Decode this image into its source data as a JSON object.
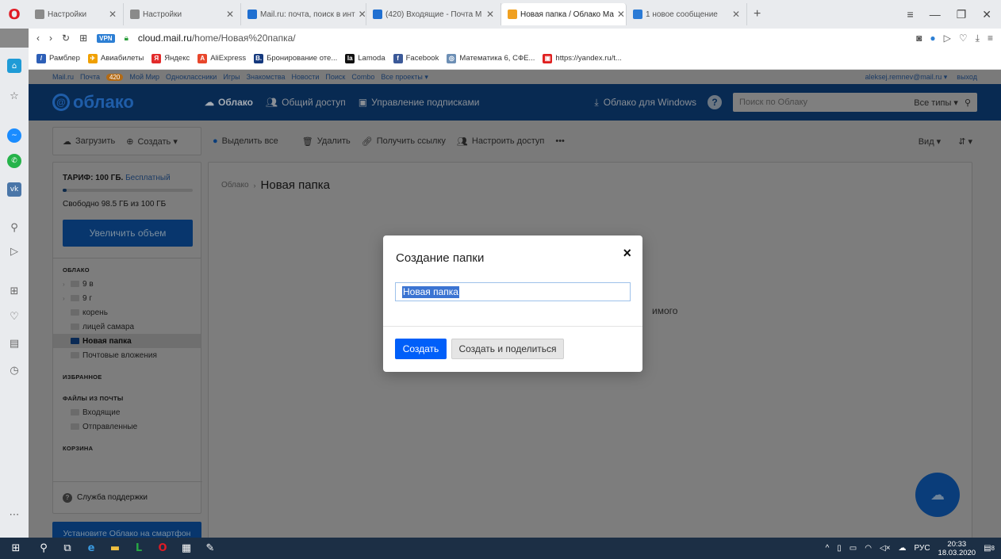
{
  "browser": {
    "tabs": [
      {
        "label": "Настройки",
        "icon": "gear-icon",
        "color": "#777777"
      },
      {
        "label": "Настройки",
        "icon": "gear-icon",
        "color": "#777777"
      },
      {
        "label": "Mail.ru: почта, поиск в инт",
        "icon": "mailru-icon",
        "color": "#1f6fd1"
      },
      {
        "label": "(420) Входящие - Почта М",
        "icon": "mail-icon",
        "color": "#1f6fd1"
      },
      {
        "label": "Новая папка / Облако Ма",
        "icon": "cloud-icon",
        "color": "#1f6fd1"
      },
      {
        "label": "1 новое сообщение",
        "icon": "message-icon",
        "color": "#2b7bd6"
      }
    ],
    "address": {
      "domain": "cloud.mail.ru",
      "path": "/home/Новая%20папка/",
      "vpn": "VPN"
    },
    "bookmarks": [
      {
        "label": "Рамблер",
        "color": "#2d5fb7",
        "glyph": "/"
      },
      {
        "label": "Авиабилеты",
        "color": "#f0a000",
        "glyph": "✈"
      },
      {
        "label": "Яндекс",
        "color": "#e32b2b",
        "glyph": "Я"
      },
      {
        "label": "AliExpress",
        "color": "#e8472c",
        "glyph": "A"
      },
      {
        "label": "Бронирование оте...",
        "color": "#15397e",
        "glyph": "B."
      },
      {
        "label": "Lamoda",
        "color": "#111111",
        "glyph": "la"
      },
      {
        "label": "Facebook",
        "color": "#3b5998",
        "glyph": "f"
      },
      {
        "label": "Математика 6, СФЕ...",
        "color": "#6d8fb5",
        "glyph": "◎"
      },
      {
        "label": "https://yandex.ru/t...",
        "color": "#e02020",
        "glyph": "▣"
      }
    ]
  },
  "portal": {
    "items": [
      "Mail.ru",
      "Почта",
      "Мой Мир",
      "Одноклассники",
      "Игры",
      "Знакомства",
      "Новости",
      "Поиск",
      "Combo",
      "Все проекты ▾"
    ],
    "mail_badge": "420",
    "user": "aleksej.remnev@mail.ru ▾",
    "logout": "выход"
  },
  "header": {
    "logo": "облако",
    "nav": [
      "Облако",
      "Общий доступ",
      "Управление подписками"
    ],
    "windows_link": "Облако для Windows",
    "search_placeholder": "Поиск по Облаку",
    "search_types": "Все типы ▾"
  },
  "toolbar": {
    "upload": "Загрузить",
    "create": "Создать ▾",
    "select_all": "Выделить все",
    "delete": "Удалить",
    "get_link": "Получить ссылку",
    "access": "Настроить доступ",
    "more": "•••",
    "view": "Вид ▾",
    "sort": "⇵ ▾"
  },
  "sidebar": {
    "tariff_label": "ТАРИФ: 100 ГБ.",
    "tariff_plan": "Бесплатный",
    "used_fraction": 0.015,
    "free_space": "Свободно 98.5 ГБ из 100 ГБ",
    "increase_button": "Увеличить объем",
    "section_cloud": "ОБЛАКО",
    "folders": [
      {
        "label": "9 в",
        "expandable": true
      },
      {
        "label": "9 г",
        "expandable": true
      },
      {
        "label": "корень",
        "expandable": false
      },
      {
        "label": "лицей самара",
        "expandable": false
      },
      {
        "label": "Новая папка",
        "expandable": false,
        "active": true
      },
      {
        "label": "Почтовые вложения",
        "expandable": false
      }
    ],
    "section_favorites": "ИЗБРАННОЕ",
    "section_mail_files": "ФАЙЛЫ ИЗ ПОЧТЫ",
    "mail_folders": [
      "Входящие",
      "Отправленные"
    ],
    "section_trash": "КОРЗИНА",
    "support": "Служба поддержки",
    "phone_banner": "Установите Облако на смартфон"
  },
  "main": {
    "breadcrumb_root": "Облако",
    "breadcrumb_current": "Новая папка",
    "empty_text_fragment": "имого"
  },
  "modal": {
    "title": "Создание папки",
    "close": "×",
    "input_value": "Новая папка",
    "create_button": "Создать",
    "create_share_button": "Создать и поделиться"
  },
  "taskbar": {
    "language": "РУС",
    "time": "20:33",
    "date": "18.03.2020",
    "notifications": "8"
  },
  "colors": {
    "accent": "#005ff9",
    "header_bg": "#082a52",
    "overlay_bg": "#7a7a7a"
  }
}
